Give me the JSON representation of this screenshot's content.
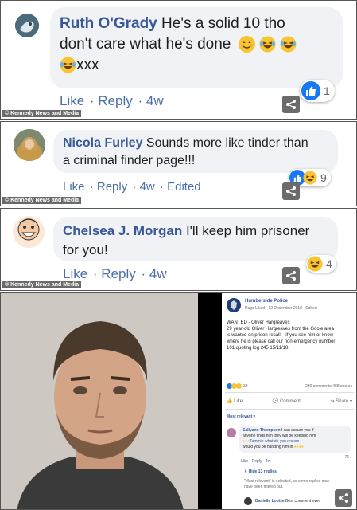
{
  "credit_text": "© Kennedy News and Media",
  "comments": [
    {
      "name": "Ruth O'Grady",
      "text_line1": " He's a solid 10 tho",
      "text_line2": "don't care what he's done",
      "text_line3": "xxx",
      "like": "Like",
      "reply": "Reply",
      "time": "4w",
      "reaction_count": "1"
    },
    {
      "name": "Nicola Furley",
      "text_line1": " Sounds more like tinder than",
      "text_line2": "a criminal finder page!!!",
      "like": "Like",
      "reply": "Reply",
      "time": "4w",
      "edited": "Edited",
      "reaction_count": "9"
    },
    {
      "name": "Chelsea J. Morgan",
      "text_line1": " I'll keep him prisoner",
      "text_line2": "for you!",
      "like": "Like",
      "reply": "Reply",
      "time": "4w",
      "reaction_count": "4"
    }
  ],
  "post": {
    "page_name": "Humberside Police",
    "meta": "Page Liked · 12 December 2018 · Edited ·",
    "body_line1": "WANTED - Oliver Hargreaves",
    "body_line2": "29 year-old Oliver Hargreaves from the Goole area",
    "body_line3": "is wanted on prison recall – if you see him or know",
    "body_line4": "where he is please call our non-emergency number",
    "body_line5": "101 quoting log 245 15/11/18.",
    "reactions_count": "38",
    "stats": "230 comments  488 shares",
    "like": "Like",
    "comment": "Comment",
    "share": "Share",
    "most_relevant": "Most relevant ▾",
    "c1_name": "Sallyann Thompson",
    "c1_line1": " I can assure you if",
    "c1_line2": "anyone finds him they will be keeping him",
    "c1_line3": "Tammie what do you reckon",
    "c1_line4": "would you be handing him in",
    "c1_count": "76",
    "c1_meta": "Like · Reply · 4w",
    "hide_replies": "↳ Hide 13 replies",
    "note_line1": "\"Most relevant\" is selected, so some replies may",
    "note_line2": "have been filtered out.",
    "c2_name": "Danielle Louise",
    "c2_text": " Best comment ever"
  }
}
